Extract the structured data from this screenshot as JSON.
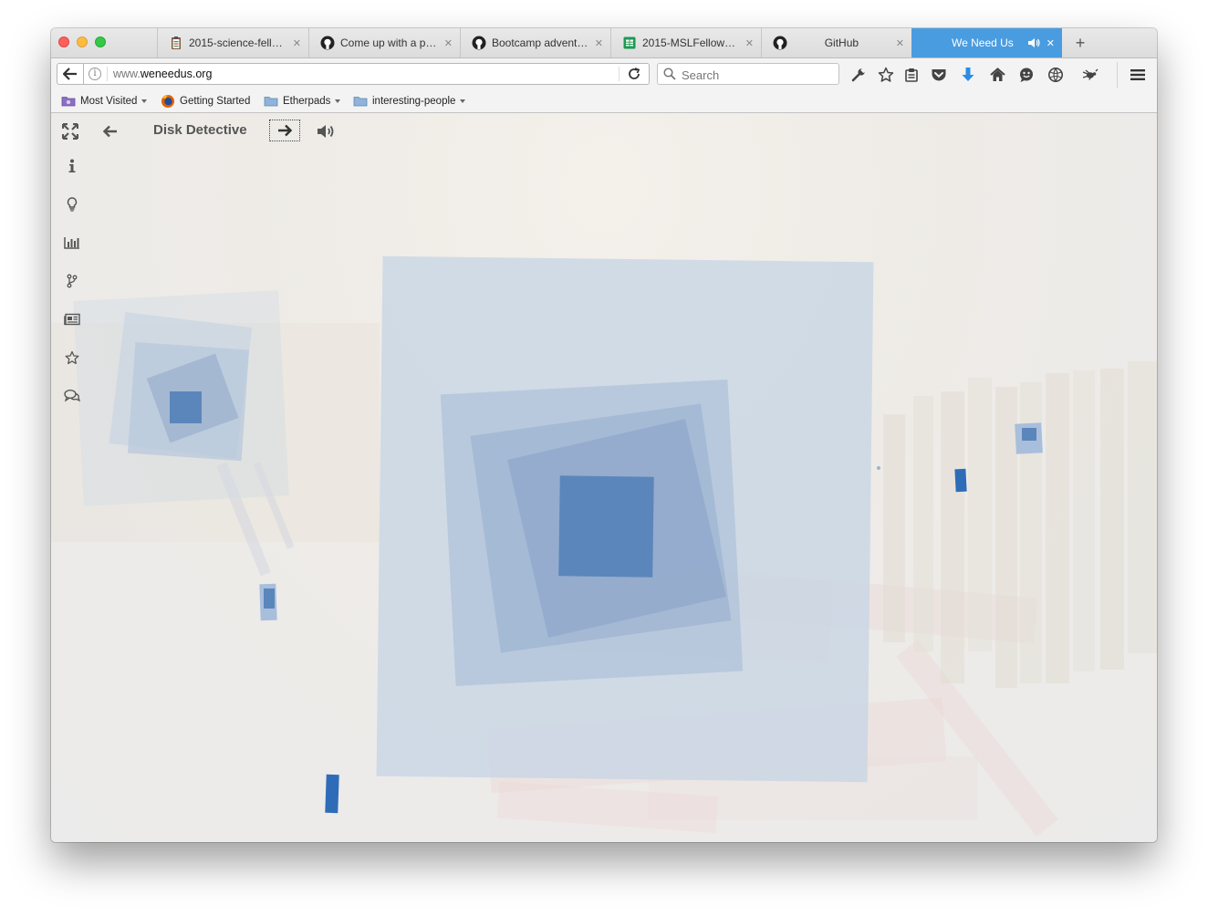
{
  "browser": {
    "tabs": [
      {
        "title": "2015-science-fello…",
        "icon": "clipboard-icon"
      },
      {
        "title": "Come up with a pr…",
        "icon": "github-icon"
      },
      {
        "title": "Bootcamp adventu…",
        "icon": "github-icon"
      },
      {
        "title": "2015-MSLFellows-…",
        "icon": "spreadsheet-icon"
      },
      {
        "title": "GitHub",
        "icon": "github-icon"
      },
      {
        "title": "We Need Us",
        "icon": "speaker-icon",
        "active": true
      }
    ],
    "close_glyph": "✕",
    "new_tab_glyph": "+",
    "url": {
      "prefix": "www.",
      "domain": "weneedus.org"
    },
    "search_placeholder": "Search",
    "toolbar_icons": [
      "wrench-icon",
      "star-icon",
      "clipboard-icon",
      "pocket-icon",
      "download-icon",
      "home-icon",
      "chat-icon",
      "globe-icon",
      "bug-icon",
      "menu-icon"
    ],
    "bookmarks": [
      {
        "label": "Most Visited",
        "icon": "most-visited-icon",
        "dropdown": true
      },
      {
        "label": "Getting Started",
        "icon": "firefox-icon",
        "dropdown": false
      },
      {
        "label": "Etherpads",
        "icon": "folder-icon",
        "dropdown": true
      },
      {
        "label": "interesting-people",
        "icon": "folder-icon",
        "dropdown": true
      }
    ]
  },
  "app": {
    "title": "Disk Detective",
    "top_controls": [
      "fullscreen-icon",
      "back-arrow-icon",
      "next-arrow-icon",
      "volume-icon"
    ],
    "side_icons": [
      "info-icon",
      "lightbulb-icon",
      "bar-chart-icon",
      "branch-icon",
      "newspaper-icon",
      "star-icon",
      "comments-icon"
    ]
  },
  "colors": {
    "active_tab": "#4a9ce0",
    "square_dark": "#5b86bb",
    "square_light": "#c6d4e4",
    "accent_blue": "#2f6cb8"
  }
}
